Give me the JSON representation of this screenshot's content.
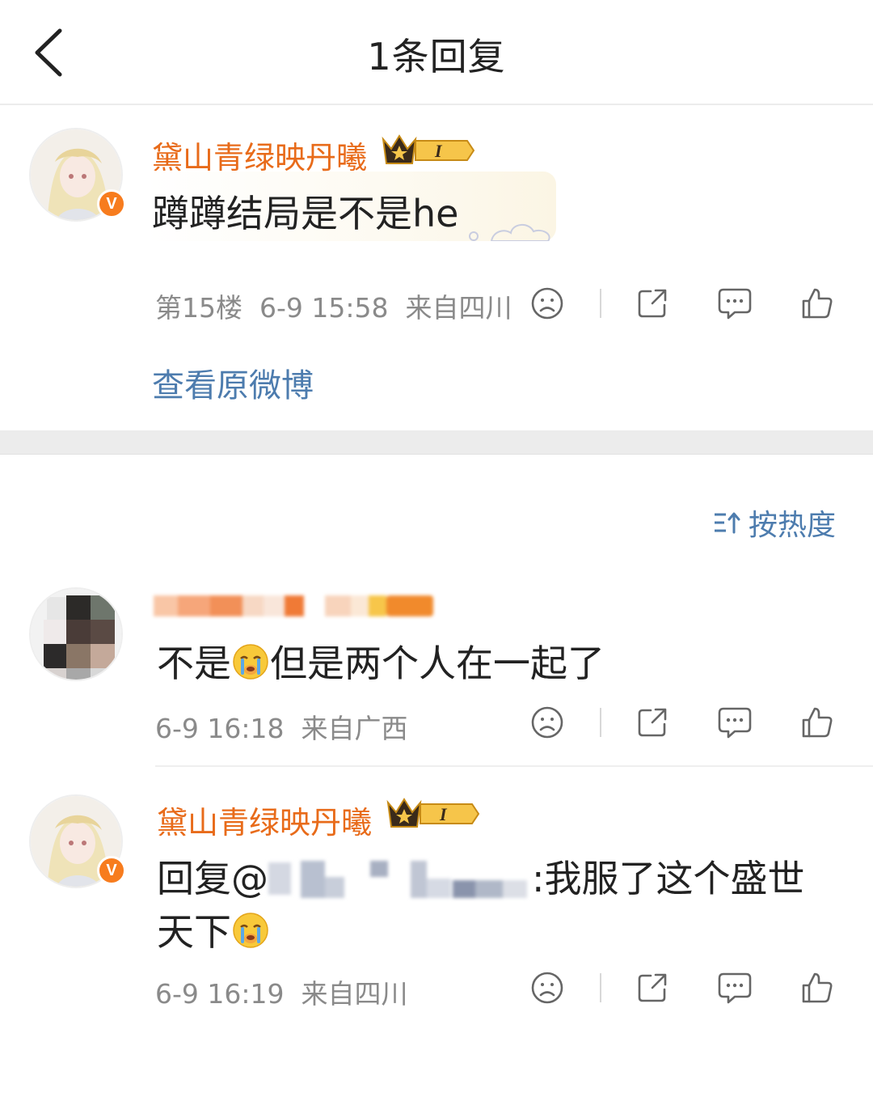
{
  "header": {
    "title": "1条回复"
  },
  "post": {
    "username": "黛山青绿映丹曦",
    "level_badge": "I",
    "text": "蹲蹲结局是不是he",
    "floor": "第15楼",
    "time": "6-9 15:58",
    "location": "来自四川",
    "view_original": "查看原微博"
  },
  "sort": {
    "label": "按热度"
  },
  "replies": [
    {
      "username": "",
      "text_a": "不是",
      "text_b": "但是两个人在一起了",
      "time": "6-9 16:18",
      "location": "来自广西"
    },
    {
      "username": "黛山青绿映丹曦",
      "level_badge": "I",
      "text_prefix": "回复@",
      "text_suffix": ":我服了这个盛世",
      "text_line2": "天下",
      "time": "6-9 16:19",
      "location": "来自四川"
    }
  ],
  "icons": {
    "back": "chevron-left-icon",
    "dislike": "sad-face-icon",
    "share": "share-icon",
    "comment": "comment-icon",
    "like": "thumbs-up-icon",
    "sort": "sort-icon",
    "verified": "verified-v-icon",
    "crown": "crown-icon",
    "crying_emoji": "crying-emoji-icon"
  },
  "colors": {
    "username": "#e86b1a",
    "link": "#4d7cae",
    "meta": "#8a8a8a",
    "verified": "#f77c1e"
  }
}
